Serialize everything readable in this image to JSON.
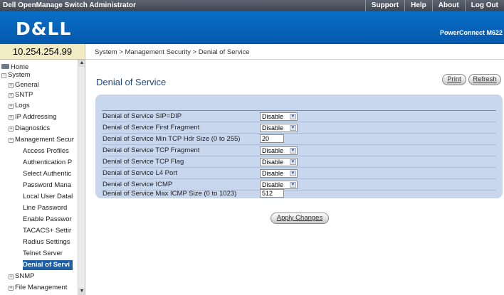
{
  "topbar": {
    "title": "Dell OpenManage Switch Administrator",
    "links": [
      "Support",
      "Help",
      "About",
      "Log Out"
    ]
  },
  "brand": {
    "logo": "D&LL",
    "product": "PowerConnect M622"
  },
  "ip_address": "10.254.254.99",
  "breadcrumb": "System > Management Security > Denial of Service",
  "tree": {
    "items": [
      {
        "label": "Home",
        "icon": "folder-icon"
      },
      {
        "label": "System",
        "expander": "minus"
      },
      {
        "label": "General",
        "expander": "plus"
      },
      {
        "label": "SNTP",
        "expander": "plus"
      },
      {
        "label": "Logs",
        "expander": "plus"
      },
      {
        "label": "IP Addressing",
        "expander": "plus"
      },
      {
        "label": "Diagnostics",
        "expander": "plus"
      },
      {
        "label": "Management Secur",
        "expander": "minus"
      },
      {
        "label": "Access Profiles"
      },
      {
        "label": "Authentication P"
      },
      {
        "label": "Select Authentic"
      },
      {
        "label": "Password Mana"
      },
      {
        "label": "Local User Datal"
      },
      {
        "label": "Line Password"
      },
      {
        "label": "Enable Passwor"
      },
      {
        "label": "TACACS+ Settir"
      },
      {
        "label": "Radius Settings"
      },
      {
        "label": "Telnet Server"
      },
      {
        "label": "Denial of Servi",
        "selected": true
      },
      {
        "label": "SNMP",
        "expander": "plus"
      },
      {
        "label": "File Management",
        "expander": "plus"
      }
    ]
  },
  "main": {
    "title": "Denial of Service",
    "print_label": "Print",
    "refresh_label": "Refresh",
    "apply_label": "Apply Changes",
    "rows": [
      {
        "label": "Denial of Service SIP=DIP",
        "type": "select",
        "value": "Disable"
      },
      {
        "label": "Denial of Service First Fragment",
        "type": "select",
        "value": "Disable"
      },
      {
        "label": "Denial of Service Min TCP Hdr Size (0 to 255)",
        "type": "text",
        "value": "20"
      },
      {
        "label": "Denial of Service TCP Fragment",
        "type": "select",
        "value": "Disable"
      },
      {
        "label": "Denial of Service TCP Flag",
        "type": "select",
        "value": "Disable"
      },
      {
        "label": "Denial of Service L4 Port",
        "type": "select",
        "value": "Disable"
      },
      {
        "label": "Denial of Service ICMP",
        "type": "select",
        "value": "Disable"
      },
      {
        "label": "Denial of Service Max ICMP Size (0 to 1023)",
        "type": "text",
        "value": "512"
      }
    ]
  },
  "colors": {
    "brand_blue": "#0459ad",
    "panel_blue": "#c9d7ee",
    "title_blue": "#1b4a8a",
    "selected_bg": "#1e5fa8",
    "ip_box": "#f2ecc4"
  }
}
